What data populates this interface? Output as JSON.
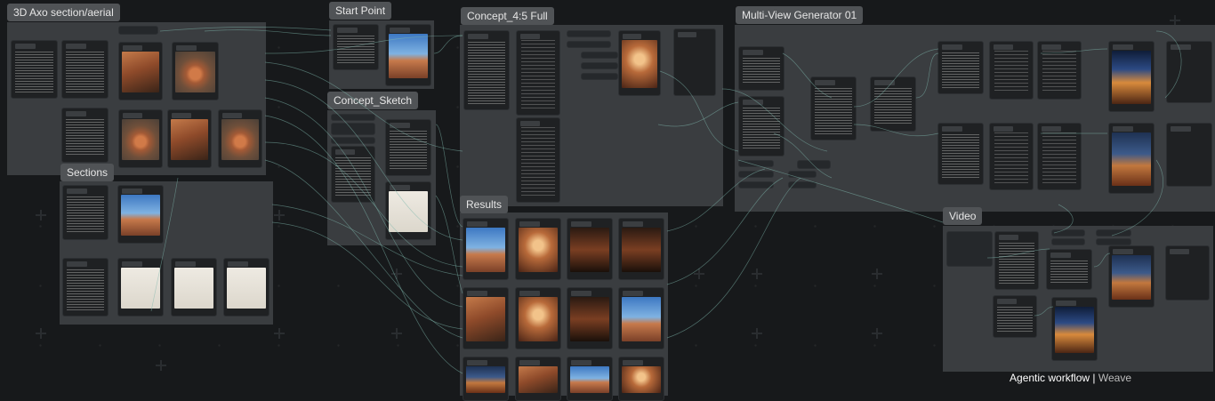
{
  "canvas": {
    "background": "#17191b",
    "group_color": "#3a3d40",
    "title_color": "#505356",
    "wire_color": "#7fb8ad"
  },
  "groups": {
    "axo": {
      "title": "3D Axo section/aerial"
    },
    "start": {
      "title": "Start Point"
    },
    "concept_full": {
      "title": "Concept_4:5 Full"
    },
    "multiview": {
      "title": "Multi-View Generator 01"
    },
    "sketch": {
      "title": "Concept_Sketch"
    },
    "sections": {
      "title": "Sections"
    },
    "results": {
      "title": "Results"
    },
    "video": {
      "title": "Video"
    }
  },
  "watermark": {
    "text": "Agentic workflow",
    "separator": " | ",
    "brand": "Weave"
  }
}
